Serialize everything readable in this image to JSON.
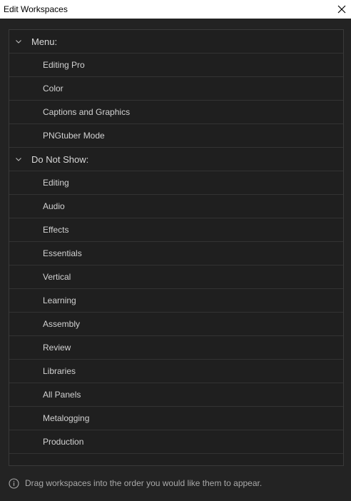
{
  "window": {
    "title": "Edit Workspaces",
    "close_icon": "close-icon"
  },
  "groups": [
    {
      "label": "Menu:",
      "items": [
        "Editing Pro",
        "Color",
        "Captions and Graphics",
        "PNGtuber Mode"
      ]
    },
    {
      "label": "Do Not Show:",
      "items": [
        "Editing",
        "Audio",
        "Effects",
        "Essentials",
        "Vertical",
        "Learning",
        "Assembly",
        "Review",
        "Libraries",
        "All Panels",
        "Metalogging",
        "Production"
      ]
    }
  ],
  "footer": {
    "icon": "info-icon",
    "text": "Drag workspaces into the order you would like them to appear."
  }
}
